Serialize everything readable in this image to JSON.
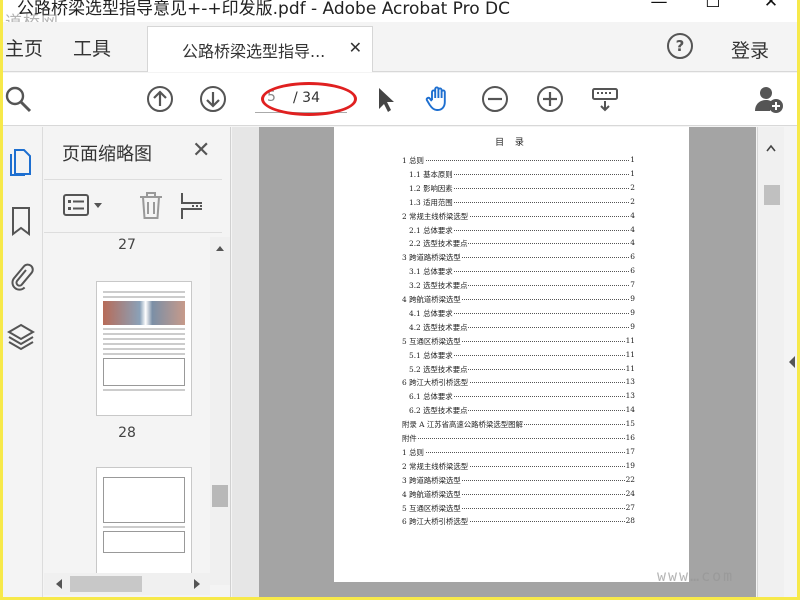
{
  "window": {
    "title": "公路桥梁选型指导意见+-+印发版.pdf - Adobe Acrobat Pro DC",
    "minimize": "—",
    "maximize": "☐",
    "close": "✕"
  },
  "watermark_top": "道桥网",
  "watermark_bottom": "www…com",
  "tabs": {
    "home": "主页",
    "tools": "工具",
    "document": "公路桥梁选型指导...",
    "document_close": "✕",
    "help": "?",
    "login": "登录"
  },
  "toolbar": {
    "page_current": "5",
    "page_total": "/ 34",
    "icons": [
      "search-icon",
      "page-up-icon",
      "page-down-icon",
      "select-cursor-icon",
      "hand-tool-icon",
      "zoom-out-icon",
      "zoom-in-icon",
      "keyboard-scroll-icon",
      "add-user-icon"
    ]
  },
  "thumbnails": {
    "title": "页面缩略图",
    "close": "✕",
    "pages": [
      {
        "label": "27"
      },
      {
        "label": "28"
      }
    ]
  },
  "toc": {
    "title": "目 录",
    "items": [
      {
        "num": "1",
        "text": "总则",
        "page": "1",
        "indent": 0
      },
      {
        "num": "1.1",
        "text": "基本原则",
        "page": "1",
        "indent": 1
      },
      {
        "num": "1.2",
        "text": "影响因素",
        "page": "2",
        "indent": 1
      },
      {
        "num": "1.3",
        "text": "适用范围",
        "page": "2",
        "indent": 1
      },
      {
        "num": "2",
        "text": "常规主线桥梁选型",
        "page": "4",
        "indent": 0
      },
      {
        "num": "2.1",
        "text": "总体要求",
        "page": "4",
        "indent": 1
      },
      {
        "num": "2.2",
        "text": "选型技术要点",
        "page": "4",
        "indent": 1
      },
      {
        "num": "3",
        "text": "跨道路桥梁选型",
        "page": "6",
        "indent": 0
      },
      {
        "num": "3.1",
        "text": "总体要求",
        "page": "6",
        "indent": 1
      },
      {
        "num": "3.2",
        "text": "选型技术要点",
        "page": "7",
        "indent": 1
      },
      {
        "num": "4",
        "text": "跨航道桥梁选型",
        "page": "9",
        "indent": 0
      },
      {
        "num": "4.1",
        "text": "总体要求",
        "page": "9",
        "indent": 1
      },
      {
        "num": "4.2",
        "text": "选型技术要点",
        "page": "9",
        "indent": 1
      },
      {
        "num": "5",
        "text": "互通区桥梁选型",
        "page": "11",
        "indent": 0
      },
      {
        "num": "5.1",
        "text": "总体要求",
        "page": "11",
        "indent": 1
      },
      {
        "num": "5.2",
        "text": "选型技术要点",
        "page": "11",
        "indent": 1
      },
      {
        "num": "6",
        "text": "跨江大桥引桥选型",
        "page": "13",
        "indent": 0
      },
      {
        "num": "6.1",
        "text": "总体要求",
        "page": "13",
        "indent": 1
      },
      {
        "num": "6.2",
        "text": "选型技术要点",
        "page": "14",
        "indent": 1
      },
      {
        "num": "",
        "text": "附录 A  江苏省高速公路桥梁选型图解",
        "page": "15",
        "indent": -1
      },
      {
        "num": "",
        "text": "附件",
        "page": "16",
        "indent": -1
      },
      {
        "num": "1",
        "text": "总则",
        "page": "17",
        "indent": 0
      },
      {
        "num": "2",
        "text": "常规主线桥梁选型",
        "page": "19",
        "indent": 0
      },
      {
        "num": "3",
        "text": "跨道路桥梁选型",
        "page": "22",
        "indent": 0
      },
      {
        "num": "4",
        "text": "跨航道桥梁选型",
        "page": "24",
        "indent": 0
      },
      {
        "num": "5",
        "text": "互通区桥梁选型",
        "page": "27",
        "indent": 0
      },
      {
        "num": "6",
        "text": "跨江大桥引桥选型",
        "page": "28",
        "indent": 0
      }
    ]
  }
}
